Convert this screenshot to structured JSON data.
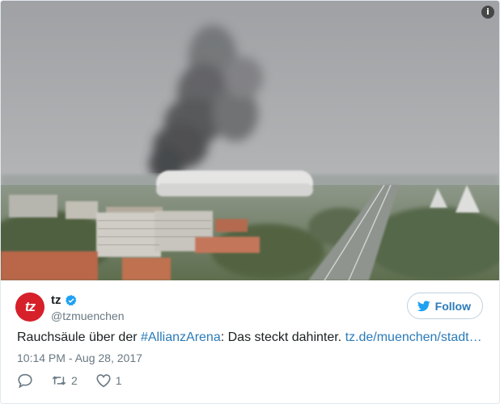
{
  "media": {
    "info_glyph": "i",
    "sky_color": "#a8aaad",
    "smoke_color": "#3a3a3c"
  },
  "author": {
    "avatar_text": "tz",
    "avatar_color": "#d6202a",
    "display_name": "tz",
    "verified": true,
    "handle": "@tzmuenchen"
  },
  "follow": {
    "label": "Follow",
    "icon": "twitter-bird-icon",
    "accent": "#2b7bb9"
  },
  "tweet": {
    "text_before": "Rauchsäule über der ",
    "hashtag": "#AllianzArena",
    "text_after": ": Das steckt dahinter. ",
    "link": "tz.de/muenchen/stadt…",
    "timestamp": "10:14 PM - Aug 28, 2017"
  },
  "actions": {
    "reply_icon": "reply-icon",
    "retweet_icon": "retweet-icon",
    "retweet_count": "2",
    "like_icon": "heart-icon",
    "like_count": "1"
  }
}
